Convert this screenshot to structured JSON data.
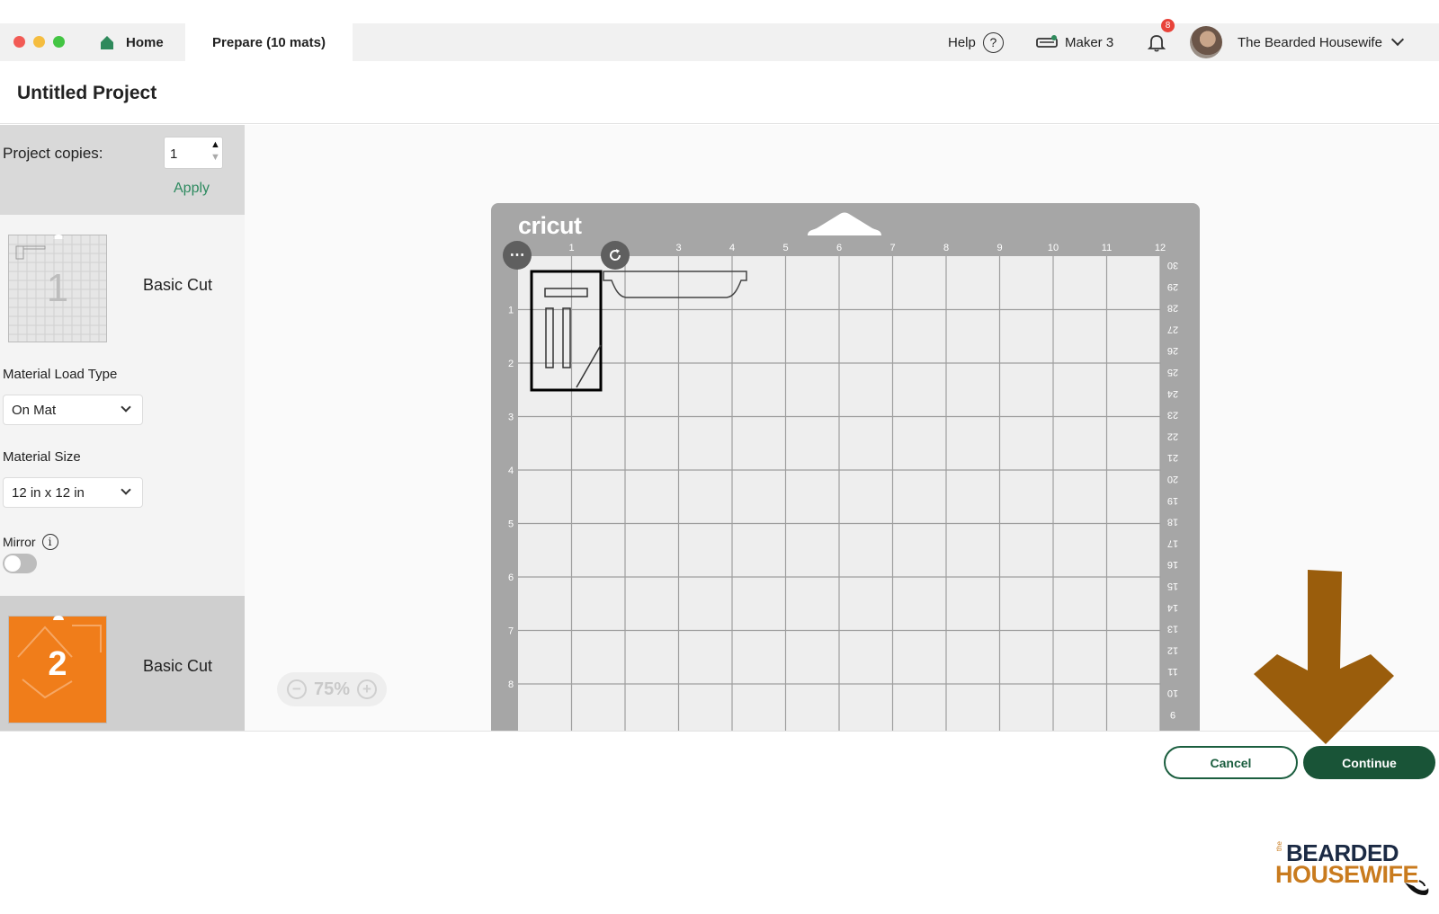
{
  "window": {
    "tabs": [
      {
        "label": "Home",
        "icon": "home-icon"
      },
      {
        "label": "Prepare (10 mats)"
      }
    ],
    "help_label": "Help",
    "help_icon_glyph": "?",
    "machine_label": "Maker 3",
    "notification_count": "8",
    "user_name": "The Bearded Housewife"
  },
  "project": {
    "title": "Untitled Project"
  },
  "sidebar": {
    "copies_label": "Project copies:",
    "copies_value": "1",
    "apply_label": "Apply",
    "mats": [
      {
        "number": "1",
        "label": "Basic Cut"
      },
      {
        "number": "2",
        "label": "Basic Cut"
      }
    ],
    "material_load_type_label": "Material Load Type",
    "material_load_type_value": "On Mat",
    "material_size_label": "Material Size",
    "material_size_value": "12 in x 12 in",
    "mirror_label": "Mirror",
    "mirror_on": false
  },
  "canvas": {
    "mat_brand": "cricut",
    "top_ruler": [
      "1",
      "",
      "3",
      "4",
      "5",
      "6",
      "7",
      "8",
      "9",
      "10",
      "11",
      "12"
    ],
    "left_ruler": [
      "1",
      "2",
      "3",
      "4",
      "5",
      "6",
      "7",
      "8"
    ],
    "right_ruler": [
      "30",
      "29",
      "28",
      "27",
      "26",
      "25",
      "24",
      "23",
      "22",
      "21",
      "20",
      "19",
      "18",
      "17",
      "16",
      "15",
      "14",
      "13",
      "12",
      "11",
      "10",
      "9"
    ],
    "zoom_level": "75%"
  },
  "footer": {
    "cancel_label": "Cancel",
    "continue_label": "Continue"
  },
  "watermark": {
    "line1": "BEARDED",
    "line_the": "the",
    "line2": "HOUSEWIFE"
  },
  "colors": {
    "accent_green": "#195437",
    "mat_gray": "#a6a6a6",
    "mat2_orange": "#f07d1a",
    "arrow_brown": "#9a5d0c"
  }
}
